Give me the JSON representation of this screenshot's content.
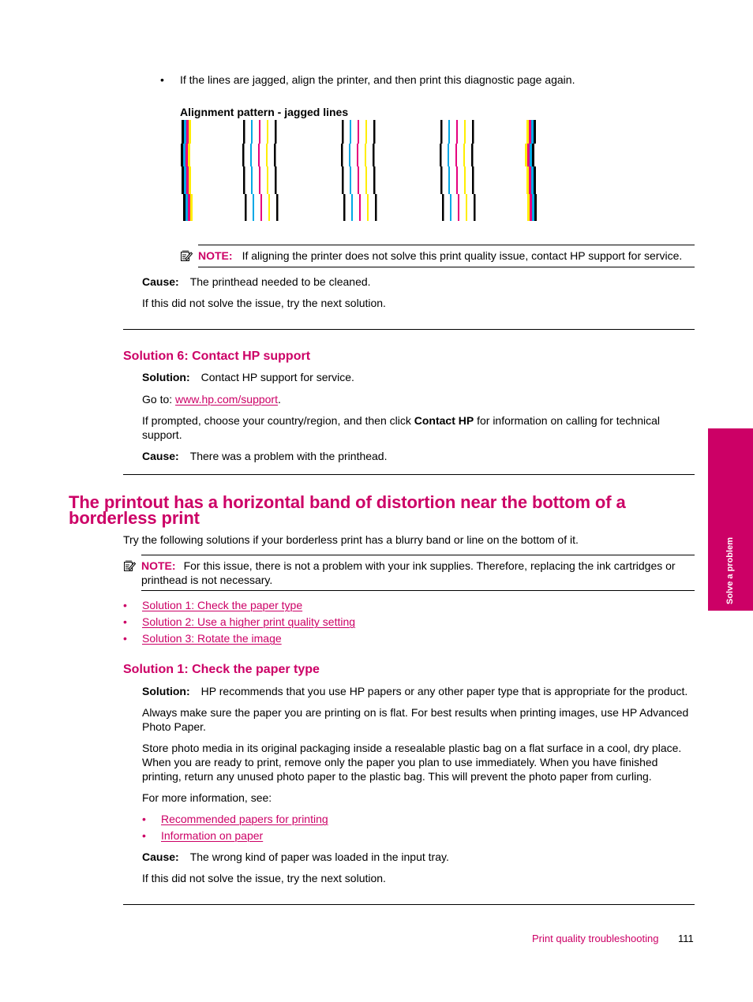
{
  "colors": {
    "accent": "#cc0066",
    "cyan": "#00a8e6",
    "magenta_ink": "#e6007e",
    "yellow": "#ffee00",
    "black": "#000000"
  },
  "section_top": {
    "bullet_jagged": "If the lines are jagged, align the printer, and then print this diagnostic page again.",
    "pattern_caption": "Alignment pattern - jagged lines",
    "pattern_groups": [
      {
        "type": "combined",
        "ink_order": [
          "black",
          "cyan",
          "magenta",
          "yellow"
        ]
      },
      {
        "type": "separated",
        "ink_order": [
          "black",
          "cyan",
          "magenta",
          "yellow",
          "black"
        ]
      },
      {
        "type": "separated",
        "ink_order": [
          "black",
          "cyan",
          "magenta",
          "yellow",
          "black"
        ]
      },
      {
        "type": "separated",
        "ink_order": [
          "black",
          "cyan",
          "magenta",
          "yellow",
          "black"
        ]
      },
      {
        "type": "combined",
        "ink_order": [
          "yellow",
          "magenta",
          "cyan",
          "black"
        ]
      }
    ],
    "note": {
      "icon": "note-pencil-icon",
      "label": "NOTE:",
      "text": "If aligning the printer does not solve this print quality issue, contact HP support for service."
    },
    "cause_label": "Cause:",
    "cause_text": "The printhead needed to be cleaned.",
    "next_text": "If this did not solve the issue, try the next solution."
  },
  "solution6": {
    "heading": "Solution 6: Contact HP support",
    "solution_label": "Solution:",
    "solution_text": "Contact HP support for service.",
    "goto_prefix": "Go to: ",
    "goto_link": "www.hp.com/support",
    "goto_suffix": ".",
    "prompt_pre": "If prompted, choose your country/region, and then click ",
    "prompt_bold": "Contact HP",
    "prompt_post": " for information on calling for technical support.",
    "cause_label": "Cause:",
    "cause_text": "There was a problem with the printhead."
  },
  "band_section": {
    "title": "The printout has a horizontal band of distortion near the bottom of a borderless print",
    "intro": "Try the following solutions if your borderless print has a blurry band or line on the bottom of it.",
    "note": {
      "icon": "note-pencil-icon",
      "label": "NOTE:",
      "text": "For this issue, there is not a problem with your ink supplies. Therefore, replacing the ink cartridges or printhead is not necessary."
    },
    "solution_links": [
      "Solution 1: Check the paper type",
      "Solution 2: Use a higher print quality setting",
      "Solution 3: Rotate the image"
    ]
  },
  "solution1": {
    "heading": "Solution 1: Check the paper type",
    "solution_label": "Solution:",
    "solution_text": "HP recommends that you use HP papers or any other paper type that is appropriate for the product.",
    "para_flat": "Always make sure the paper you are printing on is flat. For best results when printing images, use HP Advanced Photo Paper.",
    "para_store": "Store photo media in its original packaging inside a resealable plastic bag on a flat surface in a cool, dry place. When you are ready to print, remove only the paper you plan to use immediately. When you have finished printing, return any unused photo paper to the plastic bag. This will prevent the photo paper from curling.",
    "more_info": "For more information, see:",
    "links": [
      "Recommended papers for printing",
      "Information on paper"
    ],
    "cause_label": "Cause:",
    "cause_text": "The wrong kind of paper was loaded in the input tray.",
    "next_text": "If this did not solve the issue, try the next solution."
  },
  "side_tab": {
    "label": "Solve a problem"
  },
  "footer": {
    "section": "Print quality troubleshooting",
    "page_number": "111"
  }
}
